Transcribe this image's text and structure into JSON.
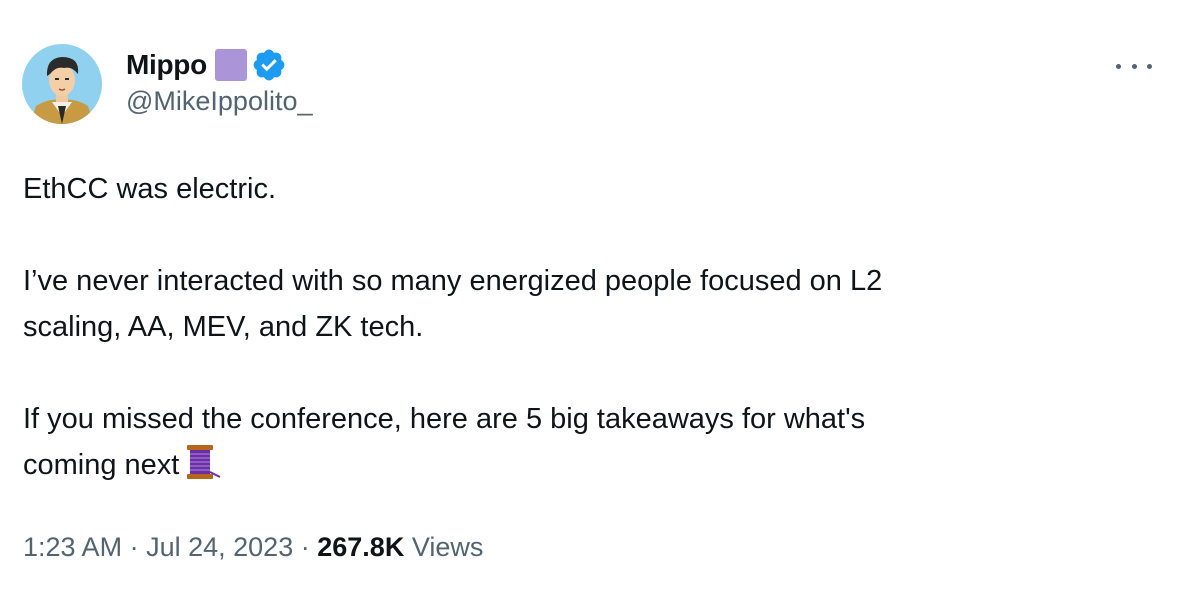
{
  "author": {
    "display_name": "Mippo",
    "handle": "@MikeIppolito_",
    "verified": true,
    "badge_color": "#ab94d8",
    "verified_color": "#1d9bf0"
  },
  "tweet": {
    "paragraphs": [
      [
        "EthCC was electric."
      ],
      [
        "I’ve never interacted with so many energized people focused on L2",
        "scaling, AA, MEV, and ZK tech."
      ],
      [
        "If you missed the conference, here are 5 big takeaways for what's",
        "coming next"
      ]
    ],
    "trailing_emoji": "thread-spool"
  },
  "meta": {
    "time": "1:23 AM",
    "separator": "·",
    "date": "Jul 24, 2023",
    "views_count": "267.8K",
    "views_label": "Views"
  },
  "icons": {
    "more": "more-horizontal-icon",
    "verified": "verified-badge-icon"
  }
}
